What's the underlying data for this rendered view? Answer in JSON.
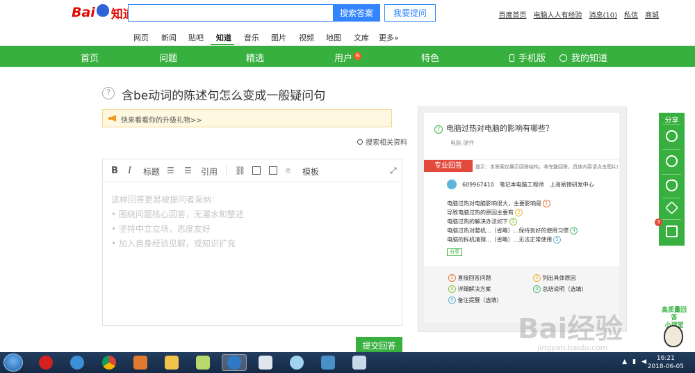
{
  "header": {
    "logo_text_a": "Bai",
    "logo_text_b": "知道",
    "search": {
      "value": "",
      "placeholder": ""
    },
    "search_button": "搜索答案",
    "ask_button": "我要提问",
    "links": [
      "百度首页",
      "电脑人人有经验",
      "消息(10)",
      "私信",
      "商城"
    ]
  },
  "channels": [
    "网页",
    "新闻",
    "贴吧",
    "知道",
    "音乐",
    "图片",
    "视频",
    "地图",
    "文库",
    "更多»"
  ],
  "channels_active_index": 3,
  "green_nav": {
    "items": [
      "首页",
      "问题",
      "精选",
      "用户",
      "特色"
    ],
    "user_badge": "N",
    "mobile": "手机版",
    "my_zhidao": "我的知道"
  },
  "question": {
    "icon": "?",
    "title": "含be动词的陈述句怎么变成一般疑问句"
  },
  "notice": {
    "text": "快来看看你的升级礼物>>"
  },
  "search_related": "搜索相关资料",
  "editor": {
    "toolbar": {
      "bold": "B",
      "italic": "I",
      "heading": "标题",
      "quote": "引用",
      "template": "模板"
    },
    "placeholder_lines": [
      "这样回答更易被提问者采纳：",
      "• 围绕问题核心回答，无灌水和整述",
      "• 坚持中立立场，态度友好",
      "• 加入自身经验见解，或知识扩充"
    ]
  },
  "submit_button": "提交回答",
  "example_card": {
    "question": "电脑过热对电脑的影响有哪些？",
    "tags": "电脑   硬件",
    "pro_label": "专业回答",
    "hint": "提示：本答案仅展示回答结构，非完整回答，具体内容请点击图片查看",
    "user_name": "609967410",
    "user_title": "笔记本电脑工程师",
    "user_org": "上海易镑研发中心",
    "lines": [
      {
        "text": "电脑过热对电脑影响很大，主要影响是",
        "num": "1",
        "cls": "n1"
      },
      {
        "text": "导致电脑过热的原因主要有",
        "num": "2",
        "cls": "n2"
      },
      {
        "text": "电脑过热的解决办法如下",
        "num": "3",
        "cls": "n3"
      },
      {
        "text": "电脑过热对整机...（省略）...保持良好的使用习惯",
        "num": "4",
        "cls": "n4"
      },
      {
        "text": "电脑的拆机清理...（省略）...无法正常使用",
        "num": "5",
        "cls": "n5"
      }
    ],
    "share_label": "分享",
    "legend": [
      {
        "num": "1",
        "text": "直接回答问题",
        "cls": "n1"
      },
      {
        "num": "2",
        "text": "列出具体原因",
        "cls": "n2"
      },
      {
        "num": "3",
        "text": "详细解决方案",
        "cls": "n3"
      },
      {
        "num": "4",
        "text": "总结说明（选填）",
        "cls": "n4"
      },
      {
        "num": "5",
        "text": "备注提醒（选填）",
        "cls": "n5"
      }
    ]
  },
  "share_sidebar": {
    "title": "分享",
    "icons": [
      "wechat-icon",
      "weibo-icon",
      "qq-icon",
      "qzone-icon",
      "task-icon"
    ],
    "badge": "3"
  },
  "watermark": {
    "big": "Bai经验",
    "small": "jingyan.baidu.com"
  },
  "mascot_text": [
    "高质量回答",
    "小课堂"
  ],
  "taskbar": {
    "time": "16:21",
    "date": "2018-06-05",
    "apps": [
      "start-orb",
      "jiang-app",
      "ie-browser",
      "chrome-browser",
      "media-player",
      "file-explorer",
      "sticky-notes",
      "search-app",
      "word-doc",
      "qq-app",
      "remote-app",
      "paint-app"
    ]
  },
  "colors": {
    "brand_blue": "#3385ff",
    "brand_green": "#38b03f",
    "red": "#e34a3b"
  }
}
